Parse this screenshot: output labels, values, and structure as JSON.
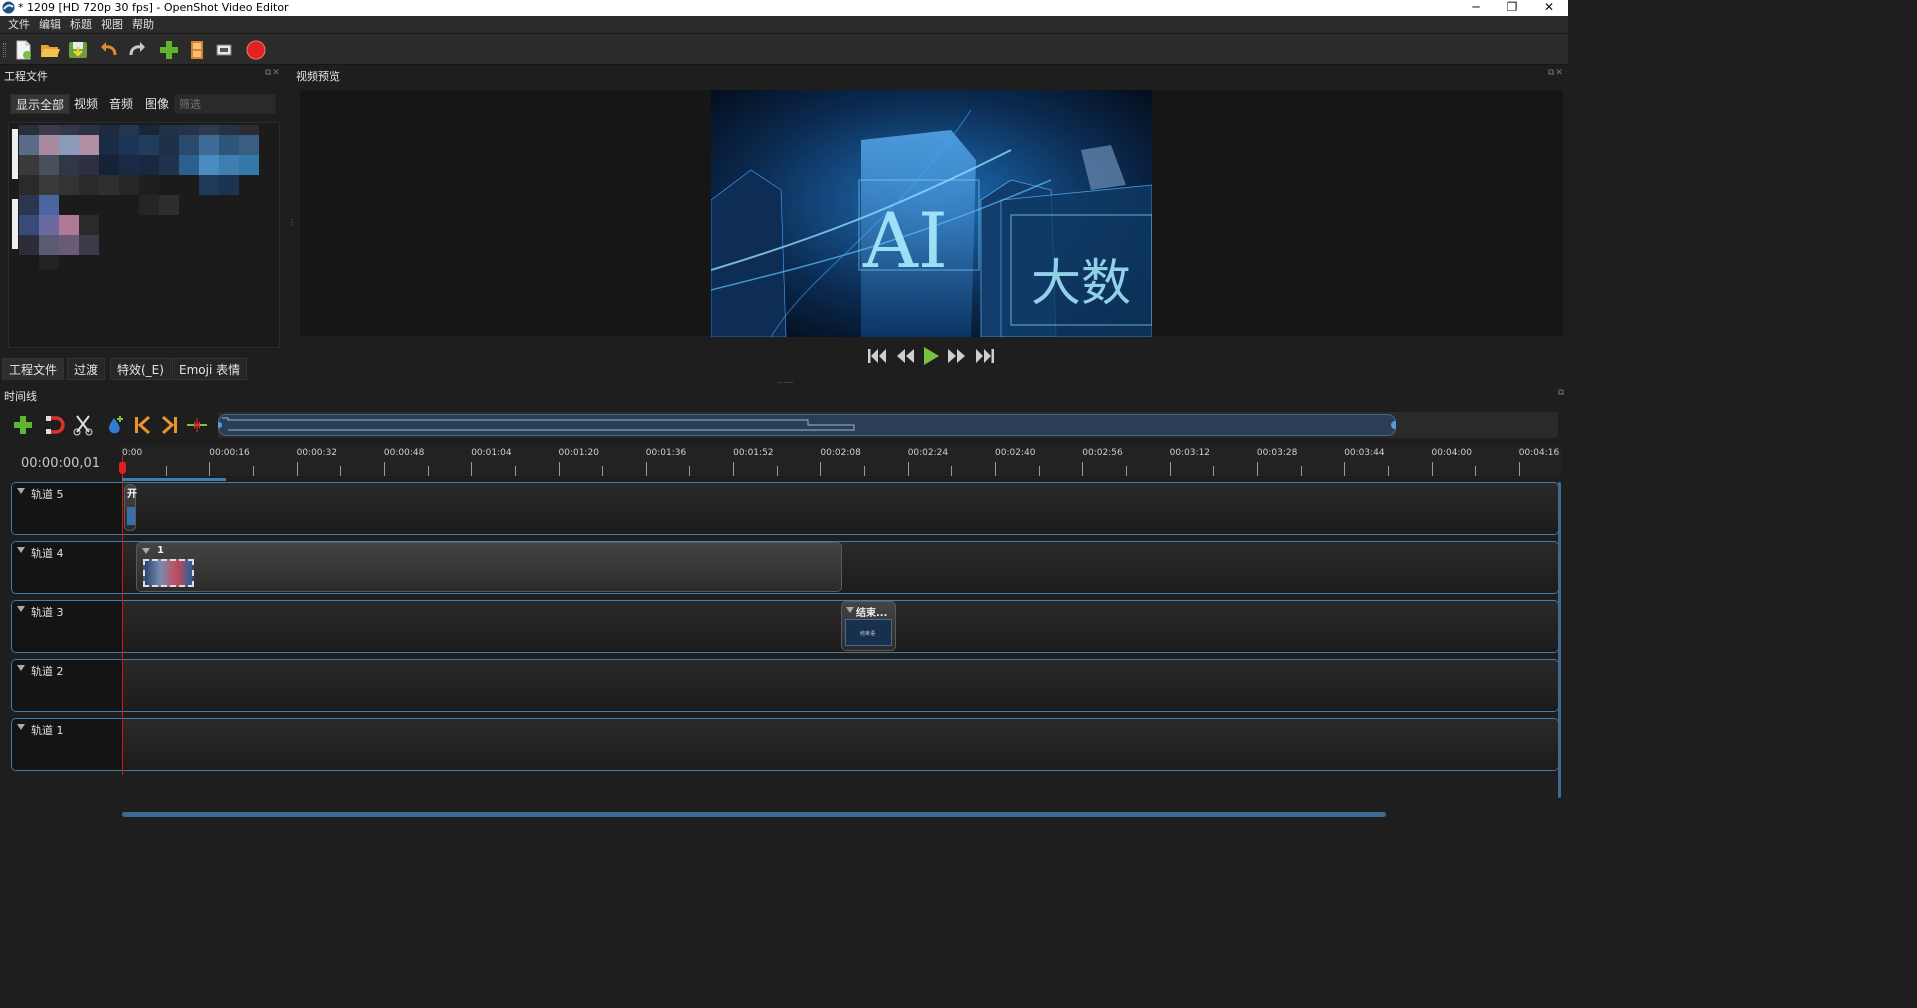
{
  "window": {
    "title": "* 1209 [HD 720p 30 fps] - OpenShot Video Editor",
    "minimize": "─",
    "restore": "❐",
    "close": "✕"
  },
  "menu": [
    "文件",
    "编辑",
    "标题",
    "视图",
    "帮助"
  ],
  "toolbar": {
    "icons": [
      "new-project-icon",
      "open-project-icon",
      "save-project-icon",
      "undo-icon",
      "redo-icon",
      "import-files-icon",
      "choose-profile-icon",
      "fullscreen-icon",
      "export-video-icon"
    ]
  },
  "project_files": {
    "title": "工程文件",
    "filters": [
      "显示全部",
      "视频",
      "音频",
      "图像"
    ],
    "active_filter": "显示全部",
    "filter_placeholder": "筛选"
  },
  "bottom_tabs": [
    "工程文件",
    "过渡",
    "特效(_E)",
    "Emoji 表情"
  ],
  "active_bottom_tab": "工程文件",
  "video_preview": {
    "title": "视频预览",
    "frame_text_ai": "AI",
    "frame_text_cn": "大数",
    "controls": [
      "jump-start-icon",
      "rewind-icon",
      "play-icon",
      "fast-forward-icon",
      "jump-end-icon"
    ]
  },
  "timeline": {
    "title": "时间线",
    "timecode": "00:00:00,01",
    "tools": [
      "add-track-icon",
      "snapping-icon",
      "razor-icon",
      "add-marker-icon",
      "previous-marker-icon",
      "next-marker-icon",
      "center-playhead-icon"
    ],
    "ruler_labels": [
      "0:00",
      "00:00:16",
      "00:00:32",
      "00:00:48",
      "00:01:04",
      "00:01:20",
      "00:01:36",
      "00:01:52",
      "00:02:08",
      "00:02:24",
      "00:02:40",
      "00:02:56",
      "00:03:12",
      "00:03:28",
      "00:03:44",
      "00:04:00",
      "00:04:16"
    ],
    "tracks": [
      {
        "name": "轨道 5"
      },
      {
        "name": "轨道 4"
      },
      {
        "name": "轨道 3"
      },
      {
        "name": "轨道 2"
      },
      {
        "name": "轨道 1"
      }
    ],
    "clips": {
      "track5_label": "开",
      "track4_label": "1",
      "track3_label": "结束...",
      "track3_thumb_text": "结束语"
    }
  },
  "colors": {
    "accent": "#4a7ba3",
    "playhead": "#d01818",
    "background": "#1e1e1e"
  }
}
